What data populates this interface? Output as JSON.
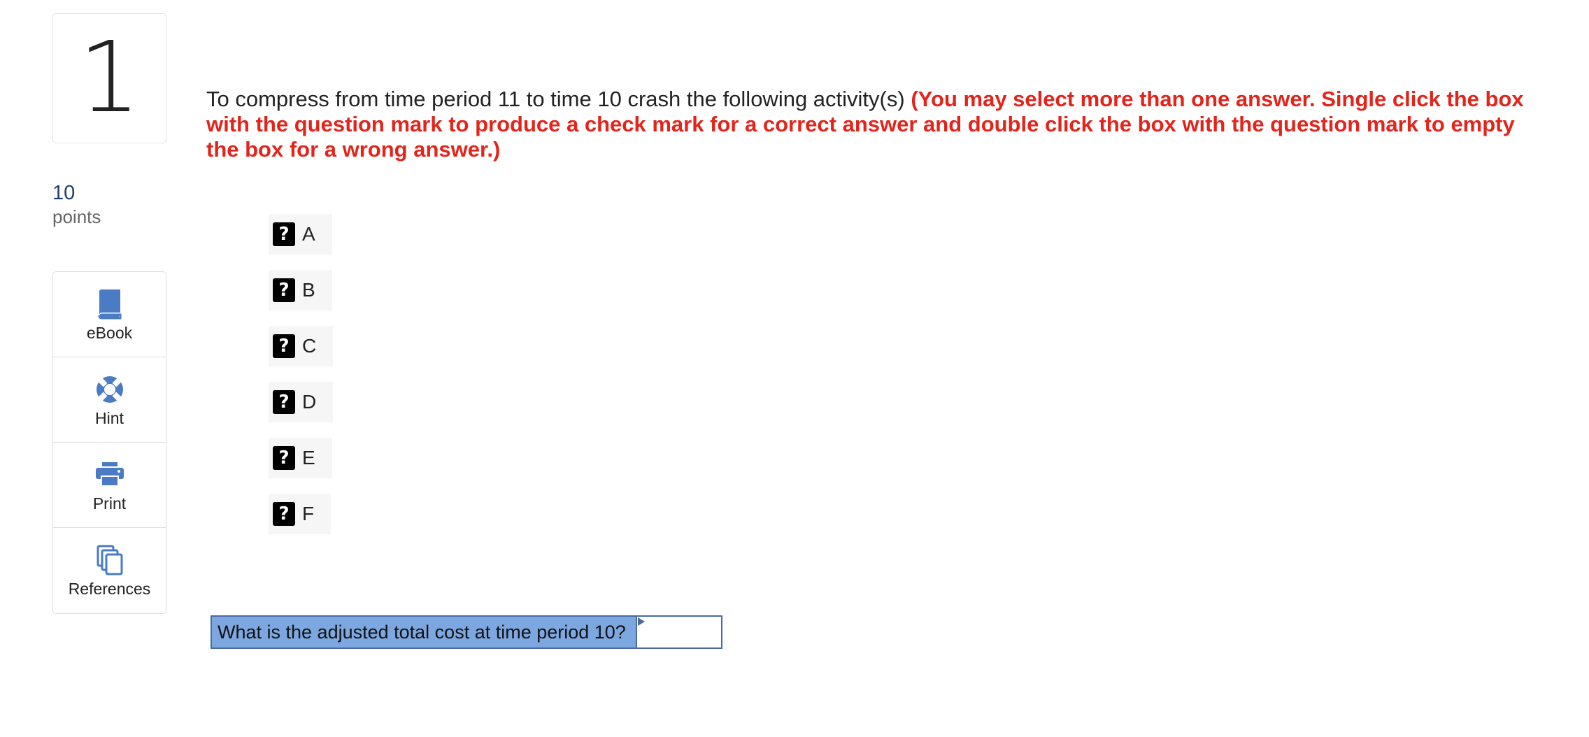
{
  "question": {
    "number": "1",
    "points_value": "10",
    "points_label": "points",
    "text": "To compress from time period 11 to time 10 crash the following activity(s)",
    "instruction": "(You may select more than one answer. Single click the box with the question mark to produce a check mark for a correct answer and double click the box with the question mark to empty the box for a wrong answer.)"
  },
  "tools": [
    {
      "label": "eBook",
      "icon": "book-icon"
    },
    {
      "label": "Hint",
      "icon": "lifebuoy-icon"
    },
    {
      "label": "Print",
      "icon": "printer-icon"
    },
    {
      "label": "References",
      "icon": "copy-icon"
    }
  ],
  "options": [
    {
      "mark": "?",
      "label": "A"
    },
    {
      "mark": "?",
      "label": "B"
    },
    {
      "mark": "?",
      "label": "C"
    },
    {
      "mark": "?",
      "label": "D"
    },
    {
      "mark": "?",
      "label": "E"
    },
    {
      "mark": "?",
      "label": "F"
    }
  ],
  "calc": {
    "label": "What is the adjusted total cost at time period 10?",
    "value": ""
  },
  "colors": {
    "instruction_red": "#e3241b",
    "icon_blue": "#4a7bc4",
    "calc_label_bg": "#7da7e0",
    "points_blue": "#1b3e70"
  }
}
